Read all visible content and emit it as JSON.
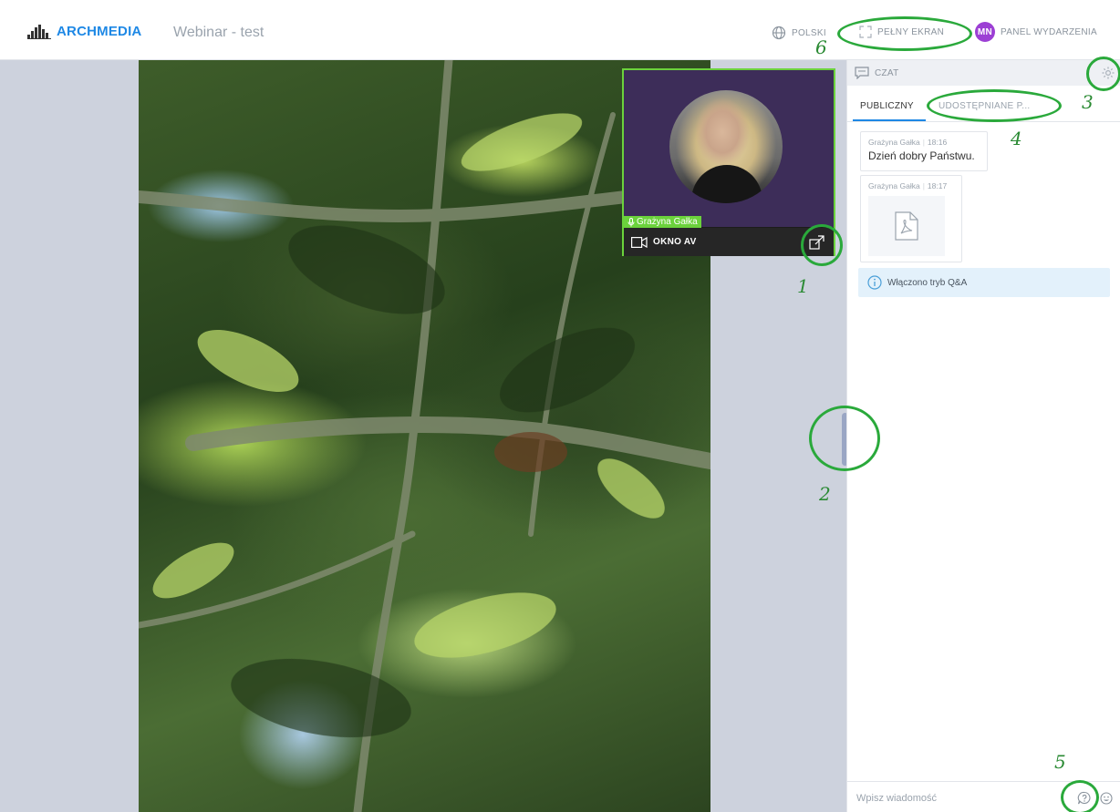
{
  "header": {
    "brand": "ARCHMEDIA",
    "event_title": "Webinar - test",
    "language_label": "POLSKI",
    "fullscreen_label": "PEŁNY EKRAN",
    "avatar_initials": "MN",
    "avatar_color": "#9c3fd4",
    "panel_label": "PANEL WYDARZENIA"
  },
  "av_window": {
    "presenter_name": "Grażyna Gałka",
    "bar_label": "OKNO AV",
    "border_color": "#6bd23c"
  },
  "chat": {
    "header_label": "CZAT",
    "tabs": [
      {
        "label": "PUBLICZNY",
        "active": true
      },
      {
        "label": "UDOSTĘPNIANE P...",
        "active": false
      }
    ],
    "messages": [
      {
        "author": "Grażyna Gałka",
        "time": "18:16",
        "text": "Dzień dobry Państwu."
      },
      {
        "author": "Grażyna Gałka",
        "time": "18:17",
        "attachment": "pdf-icon"
      }
    ],
    "notice": "Włączono tryb Q&A",
    "input_placeholder": "Wpisz wiadomość"
  },
  "annotations": [
    "1",
    "2",
    "3",
    "4",
    "5",
    "6"
  ],
  "colors": {
    "accent": "#1e88e5",
    "annotation": "#2aa93b",
    "stage_bg": "#cdd2dd"
  }
}
